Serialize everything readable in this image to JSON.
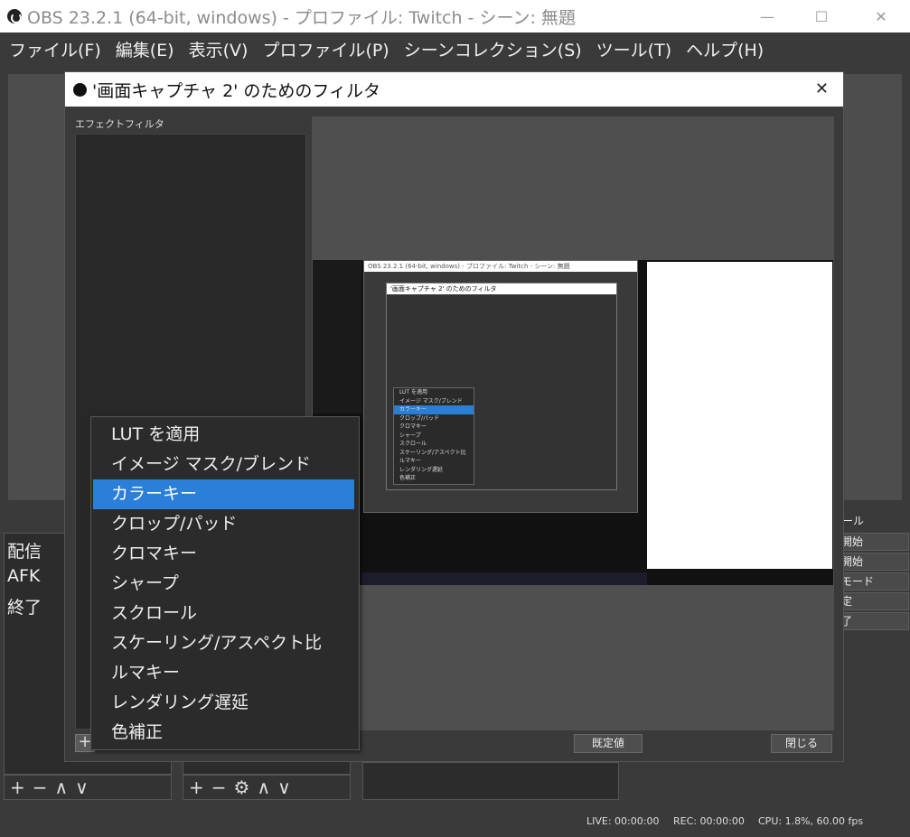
{
  "window": {
    "title": "OBS 23.2.1 (64-bit, windows) - プロファイル: Twitch - シーン: 無題",
    "minimize": "—",
    "maximize": "☐",
    "close": "✕"
  },
  "menubar": {
    "items": [
      "ファイル(F)",
      "編集(E)",
      "表示(V)",
      "プロファイル(P)",
      "シーンコレクション(S)",
      "ツール(T)",
      "ヘルプ(H)"
    ]
  },
  "scenes": {
    "items": [
      "配信",
      "AFK",
      "終了"
    ],
    "toolbar": [
      "+",
      "−",
      "∧",
      "∨"
    ]
  },
  "sources": {
    "toolbar": [
      "+",
      "−",
      "⚙",
      "∧",
      "∨"
    ]
  },
  "controls": {
    "header": "ール",
    "buttons": [
      "開始",
      "開始",
      "モード",
      "定",
      "了"
    ]
  },
  "statusbar": {
    "live": "LIVE: 00:00:00",
    "rec": "REC: 00:00:00",
    "cpu": "CPU: 1.8%, 60.00 fps"
  },
  "dialog": {
    "title": "'画面キャプチャ 2' のためのフィルタ",
    "close": "✕",
    "effect_label": "エフェクトフィルタ",
    "add": "+",
    "defaults_button": "既定値",
    "close_button": "閉じる"
  },
  "context_menu": {
    "items": [
      "LUT を適用",
      "イメージ マスク/ブレンド",
      "カラーキー",
      "クロップ/パッド",
      "クロマキー",
      "シャープ",
      "スクロール",
      "スケーリング/アスペクト比",
      "ルマキー",
      "レンダリング遅延",
      "色補正"
    ],
    "selected_index": 2
  },
  "colors": {
    "accent": "#2b7fd8",
    "background": "#3a3a3a",
    "titlebar": "#ffffff"
  }
}
